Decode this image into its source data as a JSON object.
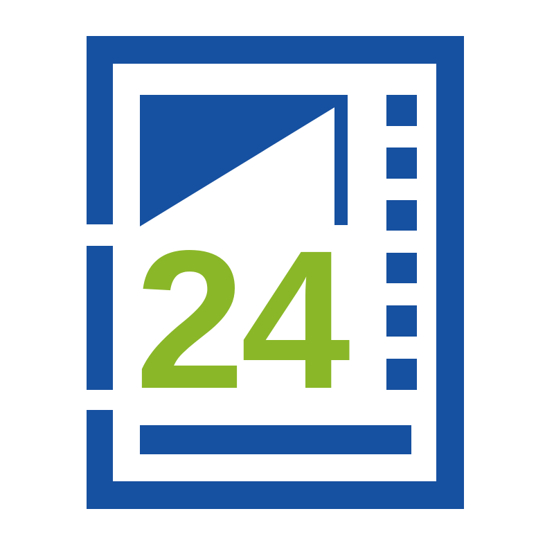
{
  "logo": {
    "number_text": "24",
    "icon_name": "film-calendar-24-logo-icon",
    "colors": {
      "primary_blue": "#1650a0",
      "accent_green": "#8ab728",
      "background": "#ffffff"
    }
  }
}
